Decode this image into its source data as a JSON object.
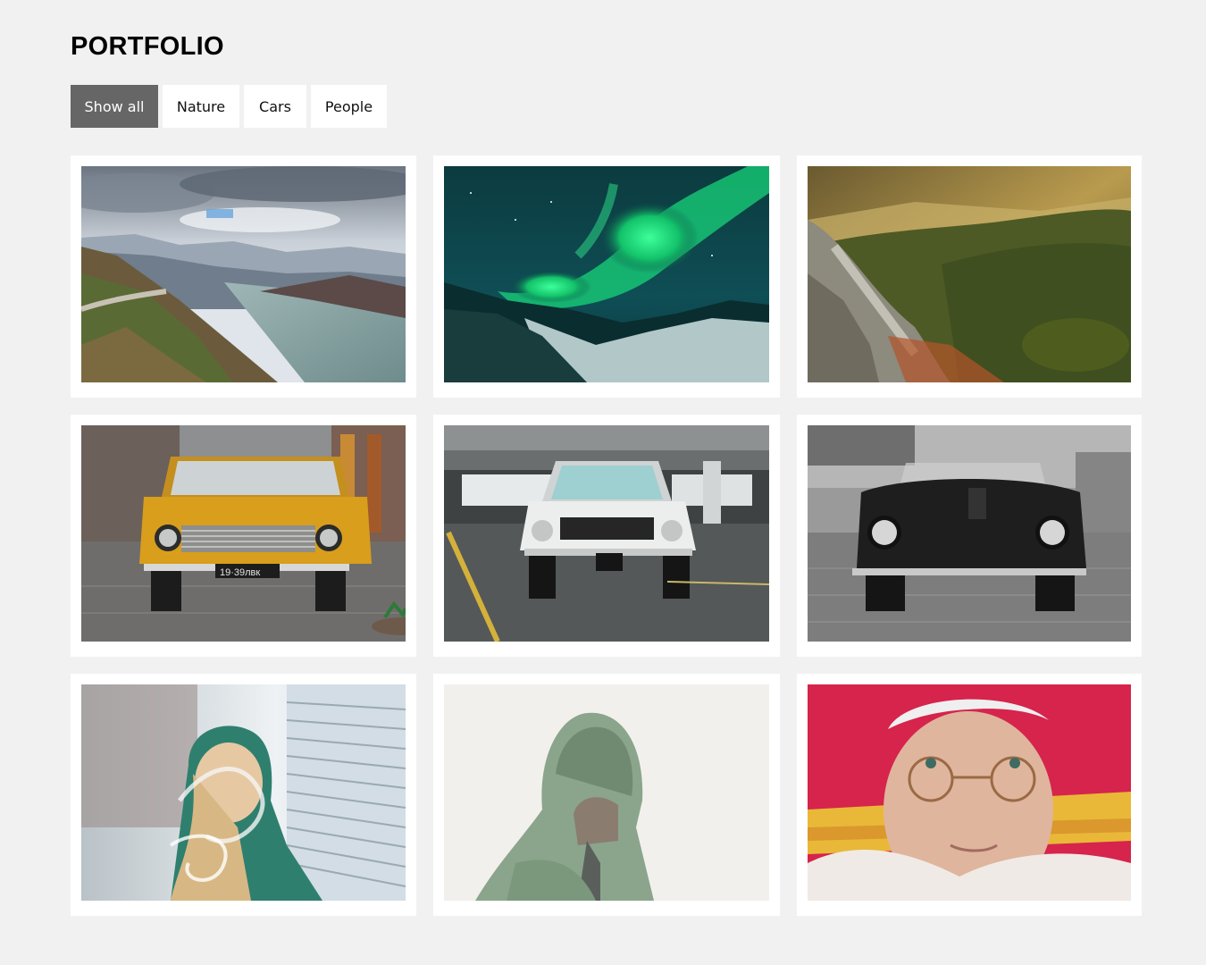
{
  "page": {
    "title": "PORTFOLIO"
  },
  "filters": [
    {
      "label": "Show all",
      "active": true
    },
    {
      "label": "Nature",
      "active": false
    },
    {
      "label": "Cars",
      "active": false
    },
    {
      "label": "People",
      "active": false
    }
  ],
  "gallery": {
    "items": [
      {
        "category": "Nature",
        "subject": "mountain lake landscape"
      },
      {
        "category": "Nature",
        "subject": "aurora borealis"
      },
      {
        "category": "Nature",
        "subject": "forested valley at sunset"
      },
      {
        "category": "Cars",
        "subject": "yellow vintage car",
        "plate": "19·39лвк"
      },
      {
        "category": "Cars",
        "subject": "white muscle car in garage"
      },
      {
        "category": "Cars",
        "subject": "black vintage convertible"
      },
      {
        "category": "People",
        "subject": "blonde girl with smoke"
      },
      {
        "category": "People",
        "subject": "man in green hoodie"
      },
      {
        "category": "People",
        "subject": "old woman in red hat"
      }
    ]
  },
  "colors": {
    "background": "#f1f1f1",
    "active_button": "#666666",
    "card": "#ffffff"
  }
}
